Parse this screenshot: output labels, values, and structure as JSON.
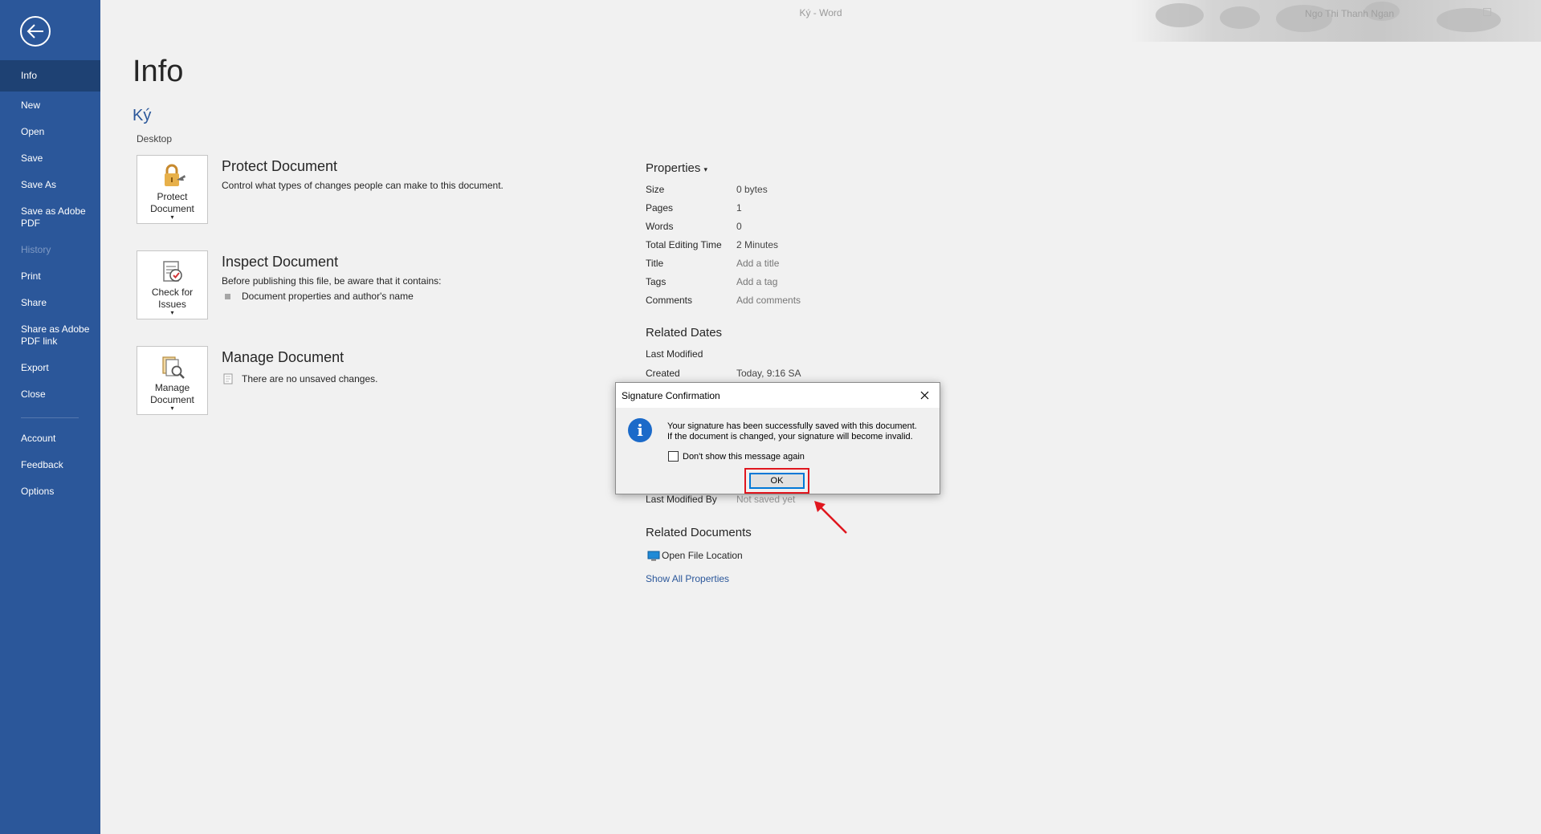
{
  "window": {
    "title": "Ký  -  Word",
    "user_name": "Ngo Thi Thanh Ngan"
  },
  "sidebar": {
    "items": [
      {
        "label": "Info",
        "state": "active"
      },
      {
        "label": "New"
      },
      {
        "label": "Open"
      },
      {
        "label": "Save"
      },
      {
        "label": "Save As"
      },
      {
        "label": "Save as Adobe PDF"
      },
      {
        "label": "History",
        "state": "disabled"
      },
      {
        "label": "Print"
      },
      {
        "label": "Share"
      },
      {
        "label": "Share as Adobe PDF link"
      },
      {
        "label": "Export"
      },
      {
        "label": "Close"
      },
      {
        "label": "Account"
      },
      {
        "label": "Feedback"
      },
      {
        "label": "Options"
      }
    ]
  },
  "main": {
    "title": "Info",
    "doc_name": "Ký",
    "doc_location": "Desktop",
    "protect": {
      "button": "Protect Document",
      "heading": "Protect Document",
      "description": "Control what types of changes people can make to this document."
    },
    "inspect": {
      "button": "Check for Issues",
      "heading": "Inspect Document",
      "description": "Before publishing this file, be aware that it contains:",
      "bullet": "Document properties and author's name"
    },
    "manage": {
      "button": "Manage Document",
      "heading": "Manage Document",
      "note": "There are no unsaved changes."
    }
  },
  "properties": {
    "heading": "Properties",
    "rows": [
      {
        "k": "Size",
        "v": "0 bytes"
      },
      {
        "k": "Pages",
        "v": "1"
      },
      {
        "k": "Words",
        "v": "0"
      },
      {
        "k": "Total Editing Time",
        "v": "2 Minutes"
      },
      {
        "k": "Title",
        "v": "Add a title"
      },
      {
        "k": "Tags",
        "v": "Add a tag"
      },
      {
        "k": "Comments",
        "v": "Add comments"
      }
    ],
    "related_dates": {
      "heading": "Related Dates",
      "last_modified": "Last Modified",
      "created_label": "Created",
      "created_value": "Today, 9:16 SA"
    },
    "last_modified_by": {
      "k": "Last Modified By",
      "v": "Not saved yet"
    },
    "related_documents": {
      "heading": "Related Documents",
      "open_location": "Open File Location",
      "show_all": "Show All Properties"
    }
  },
  "dialog": {
    "title": "Signature Confirmation",
    "message_line1": "Your signature has been successfully saved with this document.",
    "message_line2": "If the document is changed, your signature will become invalid.",
    "checkbox_label": "Don't show this message again",
    "ok_label": "OK"
  },
  "colors": {
    "sidebar": "#2b579a",
    "sidebar_active": "#1e4173",
    "accent_link": "#2b579a",
    "highlight": "#e0161e"
  }
}
